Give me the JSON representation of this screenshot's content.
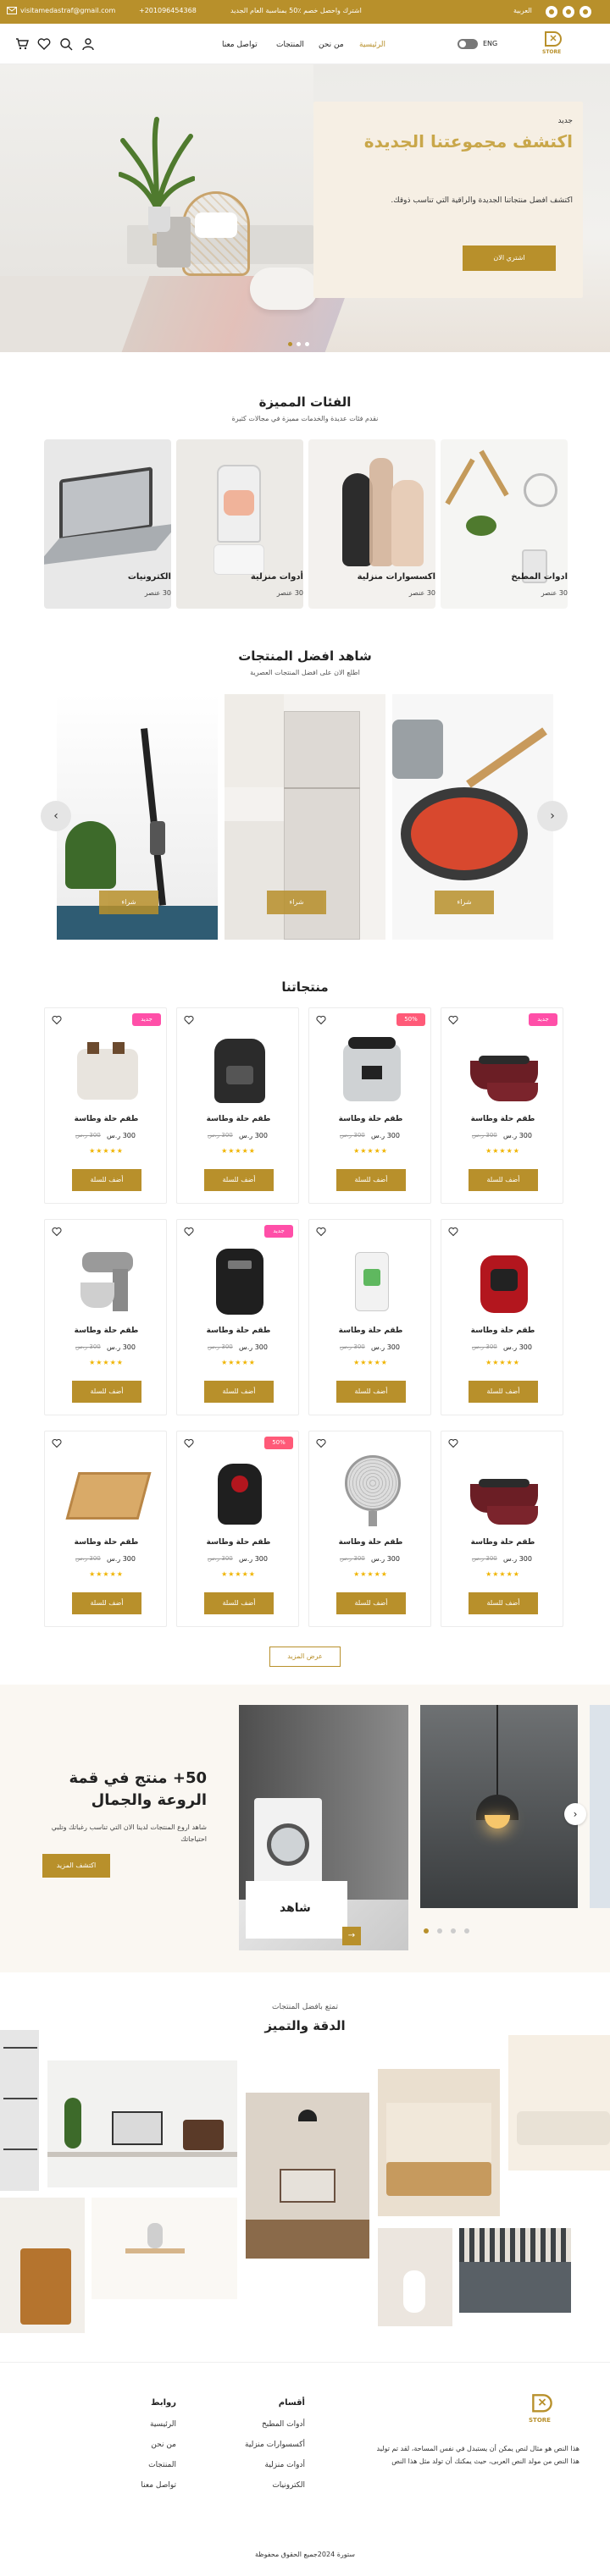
{
  "topbar": {
    "email": "visitamedastraf@gmail.com",
    "phone": "+201096454368",
    "promo": "اشترك واحصل خصم ٪50 بمناسبة العام الجديد",
    "language": "العربية"
  },
  "header": {
    "logo_text": "STORE",
    "lang_toggle": "ENG",
    "nav": [
      "الرئيسية",
      "من نحن",
      "المنتجات",
      "تواصل معنا"
    ]
  },
  "hero": {
    "kicker": "جديد",
    "title": "اكتشف مجموعتنا الجديدة",
    "description": "اكتشف افضل منتجاتنا الجديدة والراقية التي تناسب ذوقك.",
    "cta": "اشتري الان"
  },
  "categories": {
    "title": "الفئات المميزة",
    "subtitle": "نقدم فئات عديدة والخدمات مميزة في مجالات كثيرة",
    "items": [
      {
        "name": "ادوات المطبخ",
        "count": "30 عنصر"
      },
      {
        "name": "اكسسوارات منزلية",
        "count": "30 عنصر"
      },
      {
        "name": "أدوات منزلية",
        "count": "30 عنصر"
      },
      {
        "name": "الكترونيات",
        "count": "30 عنصر"
      }
    ]
  },
  "best": {
    "title": "شاهد افضل المنتجات",
    "subtitle": "اطلع الان على افضل المنتجات العصرية",
    "buy_label": "شراء"
  },
  "products": {
    "title": "منتجاتنا",
    "name": "طقم حلة وطاسة",
    "price": "300 ر.س",
    "old_price": "300 ر.س",
    "add_label": "أضف للسلة",
    "badge_new": "جديد",
    "badge_sale": "50%",
    "stars": "★★★★★",
    "more_label": "عرض المزيد"
  },
  "promo": {
    "title": "50+ منتج في قمة الروعة والجمال",
    "description": "شاهد اروع المنتجات لدينا الان التي تناسب رغباتك وتلبي احتياجاتك",
    "cta": "اكتشف المزيد",
    "card_label": "شاهد"
  },
  "gallery": {
    "kicker": "تمتع بافضل المنتجات",
    "title": "الدقة والتميز"
  },
  "footer": {
    "logo_text": "STORE",
    "about": "هذا النص هو مثال لنص يمكن أن يستبدل في نفس المساحة، لقد تم توليد هذا النص من مولد النص العربى، حيث يمكنك أن تولد مثل هذا النص",
    "col1_title": "أقسام",
    "col1": [
      "أدوات المطبخ",
      "أكسسوارات منزلية",
      "أدوات منزلية",
      "الكترونيات"
    ],
    "col2_title": "روابط",
    "col2": [
      "الرئيسية",
      "من نحن",
      "المنتجات",
      "تواصل معنا"
    ],
    "copyright": "ستورة 2024جميع الحقوق محفوظة"
  },
  "colors": {
    "gold": "#b8902b",
    "pink": "#ff4fa8",
    "sale": "#ff5a78",
    "cream": "#f6efe4"
  }
}
